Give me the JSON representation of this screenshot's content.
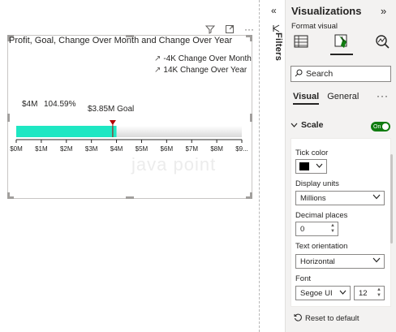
{
  "visual": {
    "title": "Profit, Goal, Change Over Month and Change Over Year",
    "header_icons": [
      "filter-icon",
      "focus-mode-icon",
      "more-options-icon"
    ],
    "more_label": "···",
    "kpis": [
      {
        "text": "-4K Change Over Month",
        "arrow": "↗"
      },
      {
        "text": "14K Change Over Year",
        "arrow": "↗"
      }
    ],
    "value_label": "$4M",
    "percent_label": "104.59%",
    "goal_label": "$3.85M Goal",
    "watermark": "java point",
    "colors": {
      "bar_fill": "#1ee7c3",
      "goal_marker": "#b40000"
    }
  },
  "chart_data": {
    "type": "bar",
    "orientation": "horizontal",
    "categories": [
      "Profit"
    ],
    "values": [
      4.0
    ],
    "goal": 3.85,
    "xlim": [
      0,
      9
    ],
    "ticks": [
      "$0M",
      "$1M",
      "$2M",
      "$3M",
      "$4M",
      "$5M",
      "$6M",
      "$7M",
      "$8M",
      "$9..."
    ],
    "tick_values": [
      0,
      1,
      2,
      3,
      4,
      5,
      6,
      7,
      8,
      9
    ]
  },
  "filters": {
    "label": "Filters",
    "collapse_icon": "«"
  },
  "pane": {
    "title": "Visualizations",
    "expand_icon": "»",
    "subtitle": "Format visual",
    "search_placeholder": "Search",
    "tabs": [
      {
        "label": "Visual",
        "active": true
      },
      {
        "label": "General",
        "active": false
      }
    ],
    "tabs_more": "···",
    "section": {
      "label": "Scale",
      "toggle": "On"
    },
    "tick_color": {
      "label": "Tick color",
      "value": "#000000"
    },
    "display_units": {
      "label": "Display units",
      "value": "Millions"
    },
    "decimal_places": {
      "label": "Decimal places",
      "value": "0"
    },
    "text_orientation": {
      "label": "Text orientation",
      "value": "Horizontal"
    },
    "font": {
      "label": "Font",
      "family": "Segoe UI",
      "size": "12"
    },
    "reset": "Reset to default"
  }
}
